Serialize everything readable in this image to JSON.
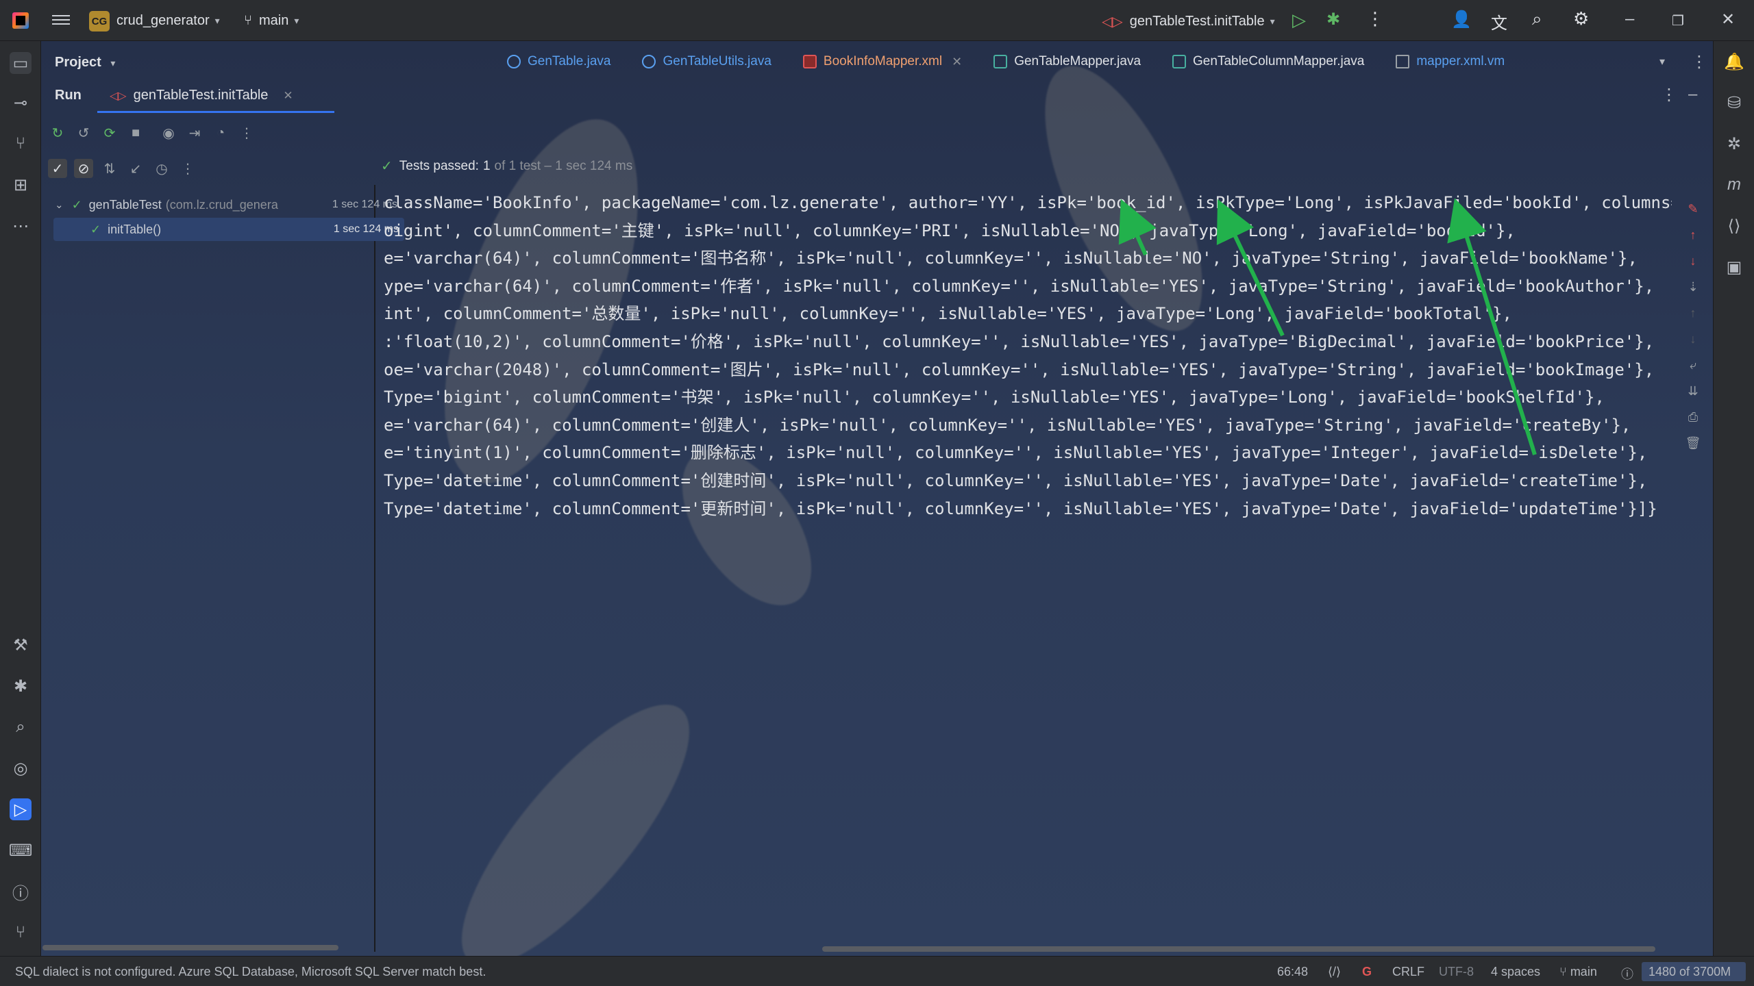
{
  "titlebar": {
    "project_badge": "CG",
    "project_name": "crud_generator",
    "branch": "main",
    "run_config": "genTableTest.initTable"
  },
  "editor_tabs": [
    {
      "label": "GenTable.java",
      "kind": "class"
    },
    {
      "label": "GenTableUtils.java",
      "kind": "class"
    },
    {
      "label": "BookInfoMapper.xml",
      "kind": "xml",
      "closable": true
    },
    {
      "label": "GenTableMapper.java",
      "kind": "java"
    },
    {
      "label": "GenTableColumnMapper.java",
      "kind": "java"
    },
    {
      "label": "mapper.xml.vm",
      "kind": "vm"
    }
  ],
  "project_panel": {
    "title": "Project"
  },
  "run_panel": {
    "title": "Run",
    "tab_label": "genTableTest.initTable",
    "status": {
      "prefix": "Tests passed:",
      "count": "1",
      "detail": "of 1 test – 1 sec 124 ms"
    },
    "tree": [
      {
        "label": "genTableTest",
        "detail": "(com.lz.crud_genera",
        "time": "1 sec 124 ms"
      },
      {
        "label": "initTable()",
        "time": "1 sec 124 ms"
      }
    ]
  },
  "console": {
    "lines": [
      "className='BookInfo', packageName='com.lz.generate', author='YY', isPk='book_id', isPkType='Long', isPkJavaFiled='bookId', columns=[",
      "oigint', columnComment='主键', isPk='null', columnKey='PRI', isNullable='NO', javaType='Long', javaField='bookId'},",
      "e='varchar(64)', columnComment='图书名称', isPk='null', columnKey='', isNullable='NO', javaType='String', javaField='bookName'},",
      "ype='varchar(64)', columnComment='作者', isPk='null', columnKey='', isNullable='YES', javaType='String', javaField='bookAuthor'},",
      "int', columnComment='总数量', isPk='null', columnKey='', isNullable='YES', javaType='Long', javaField='bookTotal'},",
      ":'float(10,2)', columnComment='价格', isPk='null', columnKey='', isNullable='YES', javaType='BigDecimal', javaField='bookPrice'},",
      "oe='varchar(2048)', columnComment='图片', isPk='null', columnKey='', isNullable='YES', javaType='String', javaField='bookImage'},",
      "Type='bigint', columnComment='书架', isPk='null', columnKey='', isNullable='YES', javaType='Long', javaField='bookShelfId'},",
      "e='varchar(64)', columnComment='创建人', isPk='null', columnKey='', isNullable='YES', javaType='String', javaField='createBy'},",
      "e='tinyint(1)', columnComment='删除标志', isPk='null', columnKey='', isNullable='YES', javaType='Integer', javaField='isDelete'},",
      "Type='datetime', columnComment='创建时间', isPk='null', columnKey='', isNullable='YES', javaType='Date', javaField='createTime'},",
      "Type='datetime', columnComment='更新时间', isPk='null', columnKey='', isNullable='YES', javaType='Date', javaField='updateTime'}]}"
    ]
  },
  "statusbar": {
    "message": "SQL dialect is not configured. Azure SQL Database, Microsoft SQL Server match best.",
    "position": "66:48",
    "line_sep": "CRLF",
    "encoding": "UTF-8",
    "indent": "4 spaces",
    "branch": "main",
    "memory": "1480 of 3700M"
  },
  "colors": {
    "accent": "#3574f0",
    "success": "#5fb865",
    "arrow": "#22b14c"
  }
}
